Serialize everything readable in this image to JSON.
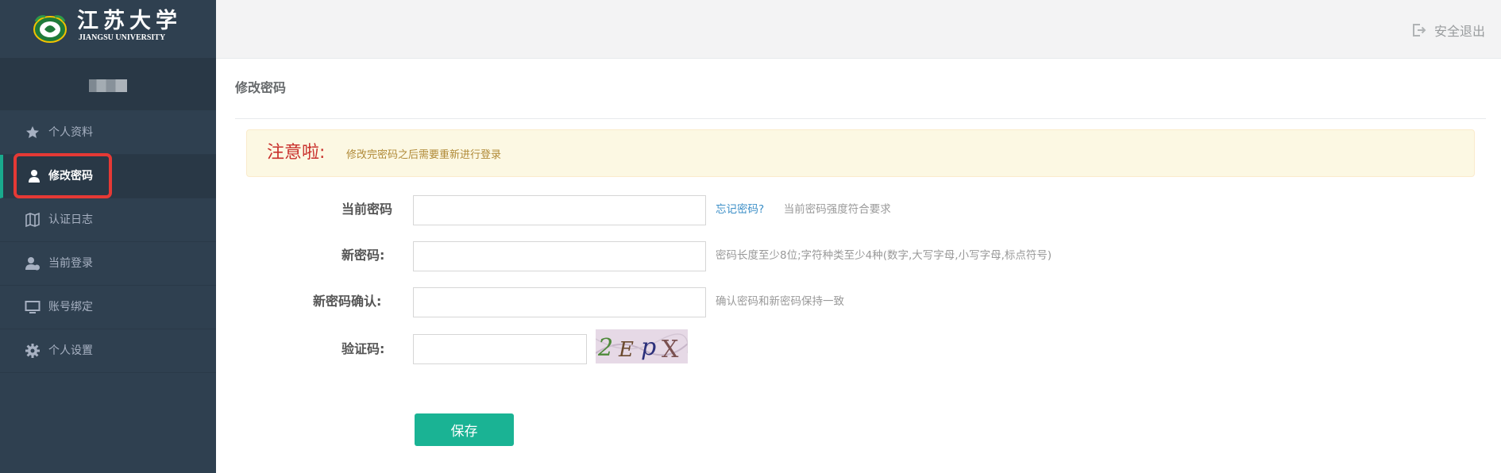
{
  "brand": {
    "name_cn": "江苏大学",
    "name_en": "JIANGSU UNIVERSITY"
  },
  "sidebar": {
    "items": [
      {
        "label": "个人资料",
        "icon": "star-icon"
      },
      {
        "label": "修改密码",
        "icon": "user-icon",
        "active": true
      },
      {
        "label": "认证日志",
        "icon": "map-icon"
      },
      {
        "label": "当前登录",
        "icon": "user-check-icon"
      },
      {
        "label": "账号绑定",
        "icon": "monitor-icon"
      },
      {
        "label": "个人设置",
        "icon": "gear-icon"
      }
    ]
  },
  "header": {
    "logout_label": "安全退出"
  },
  "page": {
    "title": "修改密码"
  },
  "alert": {
    "title": "注意啦:",
    "message": "修改完密码之后需要重新进行登录"
  },
  "form": {
    "current_password_label": "当前密码",
    "forgot_link": "忘记密码?",
    "current_password_hint": "当前密码强度符合要求",
    "new_password_label": "新密码:",
    "new_password_hint": "密码长度至少8位;字符种类至少4种(数字,大写字母,小写字母,标点符号)",
    "confirm_password_label": "新密码确认:",
    "confirm_password_hint": "确认密码和新密码保持一致",
    "captcha_label": "验证码:",
    "captcha_text": "2EpX",
    "save_label": "保存"
  },
  "colors": {
    "sidebar_bg": "#2f4050",
    "accent": "#1ab394",
    "alert_bg": "#fcf8e3",
    "alert_title": "#c9302c",
    "highlight": "#e53935"
  }
}
